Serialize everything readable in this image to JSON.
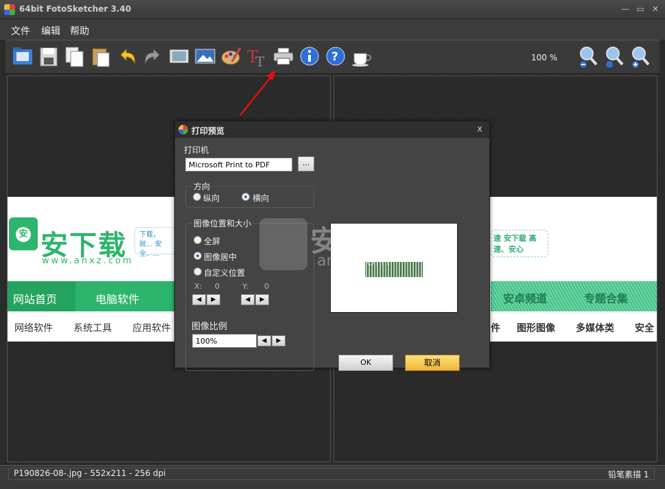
{
  "window": {
    "title": "64bit FotoSketcher 3.40",
    "min": "—",
    "max": "▭",
    "close": "✕"
  },
  "menu": {
    "file": "文件",
    "edit": "编辑",
    "help": "帮助"
  },
  "toolbar": {
    "zoom": "100 %"
  },
  "dialog": {
    "title": "打印预览",
    "close": "x",
    "printer_label": "打印机",
    "printer_value": "Microsoft Print to PDF",
    "browse": "...",
    "orientation_label": "方向",
    "portrait": "纵向",
    "landscape": "横向",
    "position_label": "图像位置和大小",
    "fullscreen": "全屏",
    "centered": "图像居中",
    "custom": "自定义位置",
    "x_label": "X:",
    "x_value": "0",
    "y_label": "Y:",
    "y_value": "0",
    "scale_label": "图像比例",
    "scale_value": "100%",
    "ok": "OK",
    "cancel": "取消"
  },
  "website": {
    "logo": "安下载",
    "url": "www.anxz.com",
    "slogan": "下载，就... 安全、...",
    "nav_home": "网站首页",
    "nav_pc": "电脑软件",
    "sub1": "网络软件",
    "sub2": "系统工具",
    "sub3": "应用软件",
    "right_slogan": "速 安下载 高速、安心",
    "right_sub1": "件",
    "right_sub2": "图形图像",
    "right_sub3": "多媒体类",
    "right_sub4": "安全",
    "right_nav1": "安卓频道",
    "right_nav2": "专题合集"
  },
  "watermark": {
    "text": "安下载",
    "url": "anxz.com"
  },
  "status": {
    "file": "P190826-08-.jpg - 552x211 - 256 dpi",
    "mode": "铅笔素描 1"
  }
}
